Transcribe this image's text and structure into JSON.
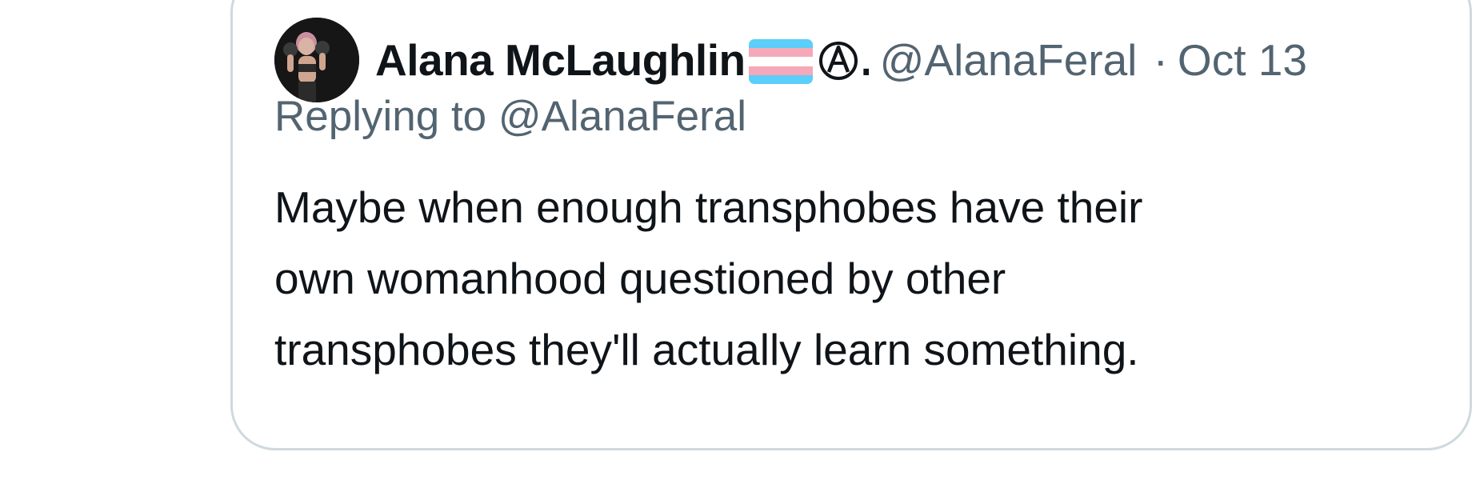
{
  "tweet": {
    "author": {
      "display_name": "Alana McLaughlin",
      "name_badges": [
        "transgender-flag-icon",
        "anarchy-symbol-icon"
      ],
      "name_truncation": ".",
      "handle": "@AlanaFeral",
      "avatar": "avatar"
    },
    "separator": "·",
    "timestamp": "Oct 13",
    "reply_context": "Replying to @AlanaFeral",
    "text_lines": [
      "Maybe when enough transphobes have their",
      "own womanhood questioned by other",
      "transphobes they'll actually learn something."
    ]
  },
  "colors": {
    "text_primary": "#0f1419",
    "text_secondary": "#536471",
    "card_border": "#cfd9de",
    "flag_blue": "#5bcefa",
    "flag_pink": "#f5a9b8",
    "flag_white": "#ffffff"
  }
}
